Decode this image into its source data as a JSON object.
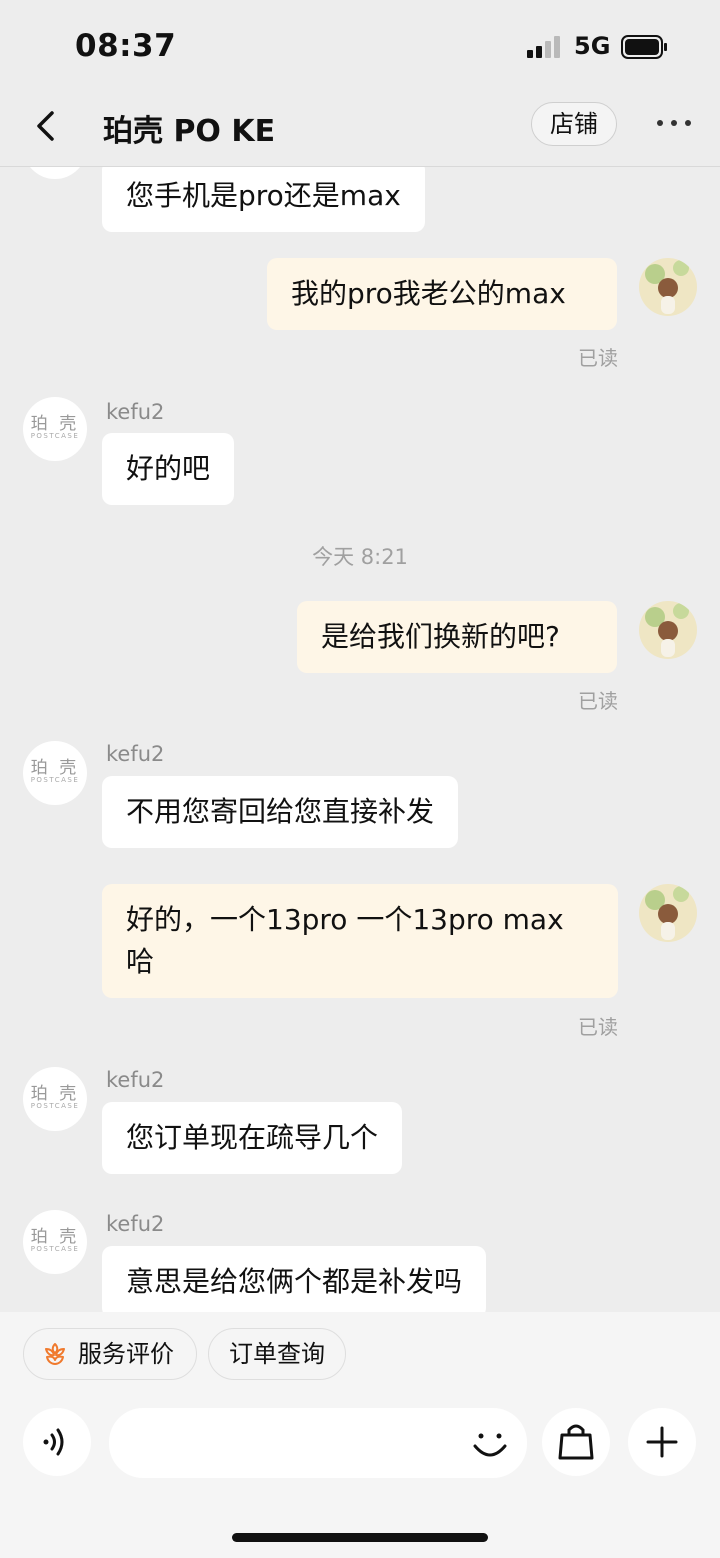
{
  "status_bar": {
    "time": "08:37",
    "network": "5G",
    "icons": [
      "signal-icon",
      "battery-icon"
    ]
  },
  "nav": {
    "back_icon": "chevron-left-icon",
    "title": "珀壳 PO KE",
    "shop_button": "店铺",
    "more_icon": "more-icon"
  },
  "shop_avatar": {
    "line1": "珀 壳",
    "line2": "POSTCASE"
  },
  "messages": [
    {
      "type": "incoming",
      "text": "您手机是pro还是max"
    },
    {
      "type": "outgoing",
      "text": "我的pro我老公的max",
      "status": "已读"
    },
    {
      "type": "incoming",
      "sender": "kefu2",
      "text": "好的吧"
    },
    {
      "type": "timestamp",
      "text": "今天 8:21"
    },
    {
      "type": "outgoing",
      "text": "是给我们换新的吧?",
      "status": "已读"
    },
    {
      "type": "incoming",
      "sender": "kefu2",
      "text": "不用您寄回给您直接补发"
    },
    {
      "type": "outgoing",
      "text": "好的，一个13pro 一个13pro max 哈",
      "status": "已读"
    },
    {
      "type": "incoming",
      "sender": "kefu2",
      "text": "您订单现在疏导几个"
    },
    {
      "type": "incoming",
      "sender": "kefu2",
      "text": "意思是给您俩个都是补发吗"
    }
  ],
  "quick_actions": [
    {
      "label": "服务评价",
      "icon": "flower-icon"
    },
    {
      "label": "订单查询"
    }
  ],
  "composer": {
    "placeholder": "",
    "icons": [
      "voice-icon",
      "emoji-icon",
      "shopping-bag-icon",
      "plus-icon"
    ]
  },
  "colors": {
    "background": "#ededed",
    "incoming_bubble": "#ffffff",
    "outgoing_bubble": "#fef6e7",
    "accent": "#f07a2e"
  }
}
